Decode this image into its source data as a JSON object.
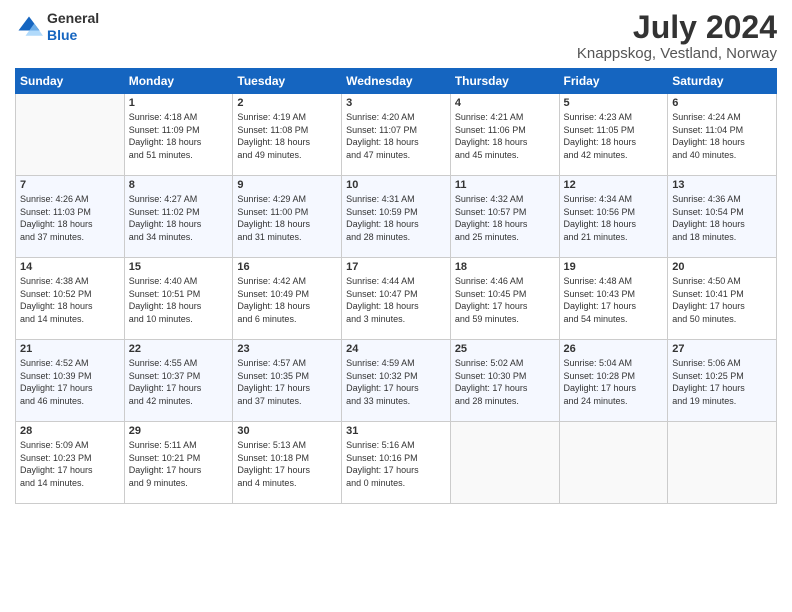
{
  "header": {
    "logo_line1": "General",
    "logo_line2": "Blue",
    "month_year": "July 2024",
    "location": "Knappskog, Vestland, Norway"
  },
  "weekdays": [
    "Sunday",
    "Monday",
    "Tuesday",
    "Wednesday",
    "Thursday",
    "Friday",
    "Saturday"
  ],
  "weeks": [
    [
      {
        "day": "",
        "info": ""
      },
      {
        "day": "1",
        "info": "Sunrise: 4:18 AM\nSunset: 11:09 PM\nDaylight: 18 hours\nand 51 minutes."
      },
      {
        "day": "2",
        "info": "Sunrise: 4:19 AM\nSunset: 11:08 PM\nDaylight: 18 hours\nand 49 minutes."
      },
      {
        "day": "3",
        "info": "Sunrise: 4:20 AM\nSunset: 11:07 PM\nDaylight: 18 hours\nand 47 minutes."
      },
      {
        "day": "4",
        "info": "Sunrise: 4:21 AM\nSunset: 11:06 PM\nDaylight: 18 hours\nand 45 minutes."
      },
      {
        "day": "5",
        "info": "Sunrise: 4:23 AM\nSunset: 11:05 PM\nDaylight: 18 hours\nand 42 minutes."
      },
      {
        "day": "6",
        "info": "Sunrise: 4:24 AM\nSunset: 11:04 PM\nDaylight: 18 hours\nand 40 minutes."
      }
    ],
    [
      {
        "day": "7",
        "info": "Sunrise: 4:26 AM\nSunset: 11:03 PM\nDaylight: 18 hours\nand 37 minutes."
      },
      {
        "day": "8",
        "info": "Sunrise: 4:27 AM\nSunset: 11:02 PM\nDaylight: 18 hours\nand 34 minutes."
      },
      {
        "day": "9",
        "info": "Sunrise: 4:29 AM\nSunset: 11:00 PM\nDaylight: 18 hours\nand 31 minutes."
      },
      {
        "day": "10",
        "info": "Sunrise: 4:31 AM\nSunset: 10:59 PM\nDaylight: 18 hours\nand 28 minutes."
      },
      {
        "day": "11",
        "info": "Sunrise: 4:32 AM\nSunset: 10:57 PM\nDaylight: 18 hours\nand 25 minutes."
      },
      {
        "day": "12",
        "info": "Sunrise: 4:34 AM\nSunset: 10:56 PM\nDaylight: 18 hours\nand 21 minutes."
      },
      {
        "day": "13",
        "info": "Sunrise: 4:36 AM\nSunset: 10:54 PM\nDaylight: 18 hours\nand 18 minutes."
      }
    ],
    [
      {
        "day": "14",
        "info": "Sunrise: 4:38 AM\nSunset: 10:52 PM\nDaylight: 18 hours\nand 14 minutes."
      },
      {
        "day": "15",
        "info": "Sunrise: 4:40 AM\nSunset: 10:51 PM\nDaylight: 18 hours\nand 10 minutes."
      },
      {
        "day": "16",
        "info": "Sunrise: 4:42 AM\nSunset: 10:49 PM\nDaylight: 18 hours\nand 6 minutes."
      },
      {
        "day": "17",
        "info": "Sunrise: 4:44 AM\nSunset: 10:47 PM\nDaylight: 18 hours\nand 3 minutes."
      },
      {
        "day": "18",
        "info": "Sunrise: 4:46 AM\nSunset: 10:45 PM\nDaylight: 17 hours\nand 59 minutes."
      },
      {
        "day": "19",
        "info": "Sunrise: 4:48 AM\nSunset: 10:43 PM\nDaylight: 17 hours\nand 54 minutes."
      },
      {
        "day": "20",
        "info": "Sunrise: 4:50 AM\nSunset: 10:41 PM\nDaylight: 17 hours\nand 50 minutes."
      }
    ],
    [
      {
        "day": "21",
        "info": "Sunrise: 4:52 AM\nSunset: 10:39 PM\nDaylight: 17 hours\nand 46 minutes."
      },
      {
        "day": "22",
        "info": "Sunrise: 4:55 AM\nSunset: 10:37 PM\nDaylight: 17 hours\nand 42 minutes."
      },
      {
        "day": "23",
        "info": "Sunrise: 4:57 AM\nSunset: 10:35 PM\nDaylight: 17 hours\nand 37 minutes."
      },
      {
        "day": "24",
        "info": "Sunrise: 4:59 AM\nSunset: 10:32 PM\nDaylight: 17 hours\nand 33 minutes."
      },
      {
        "day": "25",
        "info": "Sunrise: 5:02 AM\nSunset: 10:30 PM\nDaylight: 17 hours\nand 28 minutes."
      },
      {
        "day": "26",
        "info": "Sunrise: 5:04 AM\nSunset: 10:28 PM\nDaylight: 17 hours\nand 24 minutes."
      },
      {
        "day": "27",
        "info": "Sunrise: 5:06 AM\nSunset: 10:25 PM\nDaylight: 17 hours\nand 19 minutes."
      }
    ],
    [
      {
        "day": "28",
        "info": "Sunrise: 5:09 AM\nSunset: 10:23 PM\nDaylight: 17 hours\nand 14 minutes."
      },
      {
        "day": "29",
        "info": "Sunrise: 5:11 AM\nSunset: 10:21 PM\nDaylight: 17 hours\nand 9 minutes."
      },
      {
        "day": "30",
        "info": "Sunrise: 5:13 AM\nSunset: 10:18 PM\nDaylight: 17 hours\nand 4 minutes."
      },
      {
        "day": "31",
        "info": "Sunrise: 5:16 AM\nSunset: 10:16 PM\nDaylight: 17 hours\nand 0 minutes."
      },
      {
        "day": "",
        "info": ""
      },
      {
        "day": "",
        "info": ""
      },
      {
        "day": "",
        "info": ""
      }
    ]
  ]
}
